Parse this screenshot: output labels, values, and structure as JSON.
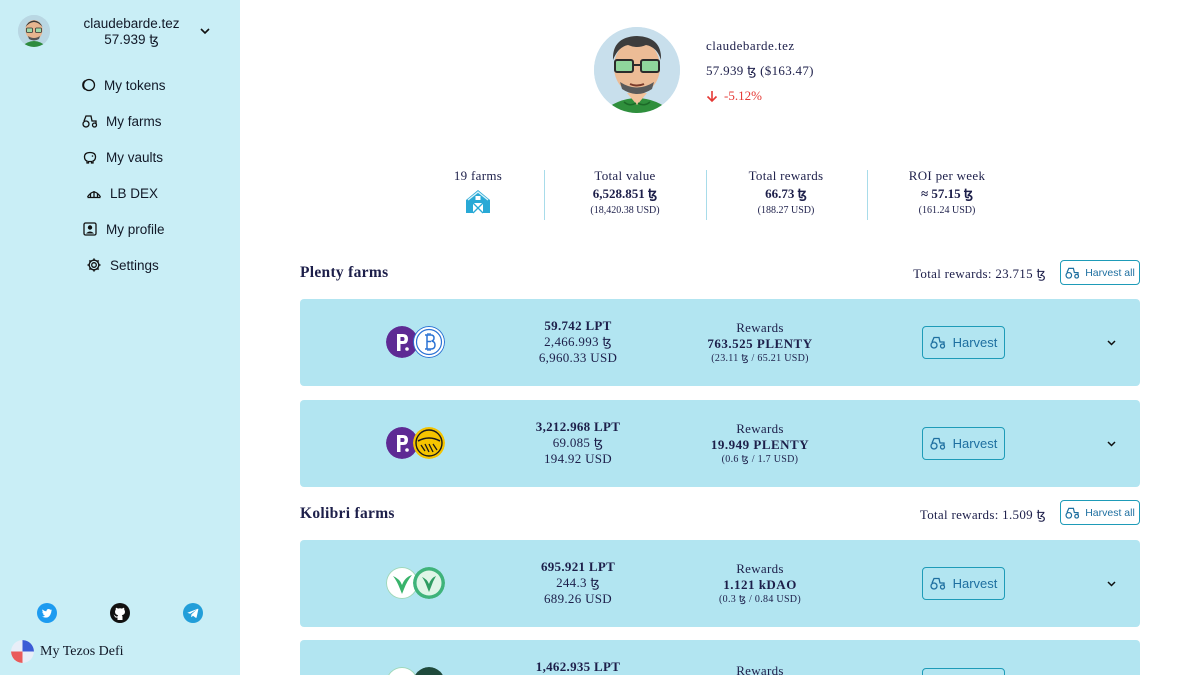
{
  "sidebar": {
    "account": {
      "name": "claudebarde.tez",
      "balance": "57.939 ꜩ"
    },
    "nav": [
      {
        "label": "My tokens",
        "icon": "coins-icon"
      },
      {
        "label": "My farms",
        "icon": "tractor-icon"
      },
      {
        "label": "My vaults",
        "icon": "piggy-bank-icon"
      },
      {
        "label": "LB DEX",
        "icon": "bank-icon"
      },
      {
        "label": "My profile",
        "icon": "profile-icon"
      },
      {
        "label": "Settings",
        "icon": "gear-icon"
      }
    ],
    "social": [
      "twitter-icon",
      "github-icon",
      "telegram-icon"
    ],
    "brand": "My Tezos Defi"
  },
  "profile": {
    "name": "claudebarde.tez",
    "balance": "57.939 ꜩ ($163.47)",
    "change": "-5.12%"
  },
  "stats": {
    "farms": "19 farms",
    "total_value": {
      "label": "Total value",
      "value": "6,528.851 ꜩ",
      "usd": "(18,420.38 USD)"
    },
    "total_rewards": {
      "label": "Total rewards",
      "value": "66.73 ꜩ",
      "usd": "(188.27 USD)"
    },
    "roi": {
      "label": "ROI per week",
      "value": "≈ 57.15 ꜩ",
      "usd": "(161.24 USD)"
    }
  },
  "sections": [
    {
      "title": "Plenty farms",
      "total_rewards": "Total rewards: 23.715 ꜩ",
      "harvest_all": "Harvest all",
      "farms": [
        {
          "lpt": "59.742 LPT",
          "xtz": "2,466.993 ꜩ",
          "usd": "6,960.33 USD",
          "rewards_label": "Rewards",
          "rewards": "763.525 PLENTY",
          "rewards_sub": "(23.11 ꜩ / 65.21 USD)",
          "harvest": "Harvest",
          "tokens": [
            "plenty-token-icon",
            "tzbtc-token-icon"
          ]
        },
        {
          "lpt": "3,212.968 LPT",
          "xtz": "69.085 ꜩ",
          "usd": "194.92 USD",
          "rewards_label": "Rewards",
          "rewards": "19.949 PLENTY",
          "rewards_sub": "(0.6 ꜩ / 1.7 USD)",
          "harvest": "Harvest",
          "tokens": [
            "plenty-token-icon",
            "yellow-token-icon"
          ]
        }
      ]
    },
    {
      "title": "Kolibri farms",
      "total_rewards": "Total rewards: 1.509 ꜩ",
      "harvest_all": "Harvest all",
      "farms": [
        {
          "lpt": "695.921 LPT",
          "xtz": "244.3 ꜩ",
          "usd": "689.26 USD",
          "rewards_label": "Rewards",
          "rewards": "1.121 kDAO",
          "rewards_sub": "(0.3 ꜩ / 0.84 USD)",
          "harvest": "Harvest",
          "tokens": [
            "kolibri-token-icon",
            "kdao-token-icon"
          ]
        },
        {
          "lpt": "1,462.935 LPT",
          "rewards_label": "Rewards",
          "tokens": [
            "kolibri-token-icon",
            "dark-token-icon"
          ]
        }
      ]
    }
  ],
  "colors": {
    "sidebar_bg": "#c9eef6",
    "card_bg": "#b2e5f1",
    "accent": "#1e9bb8",
    "negative": "#e53935",
    "text": "#1d1f4a"
  }
}
